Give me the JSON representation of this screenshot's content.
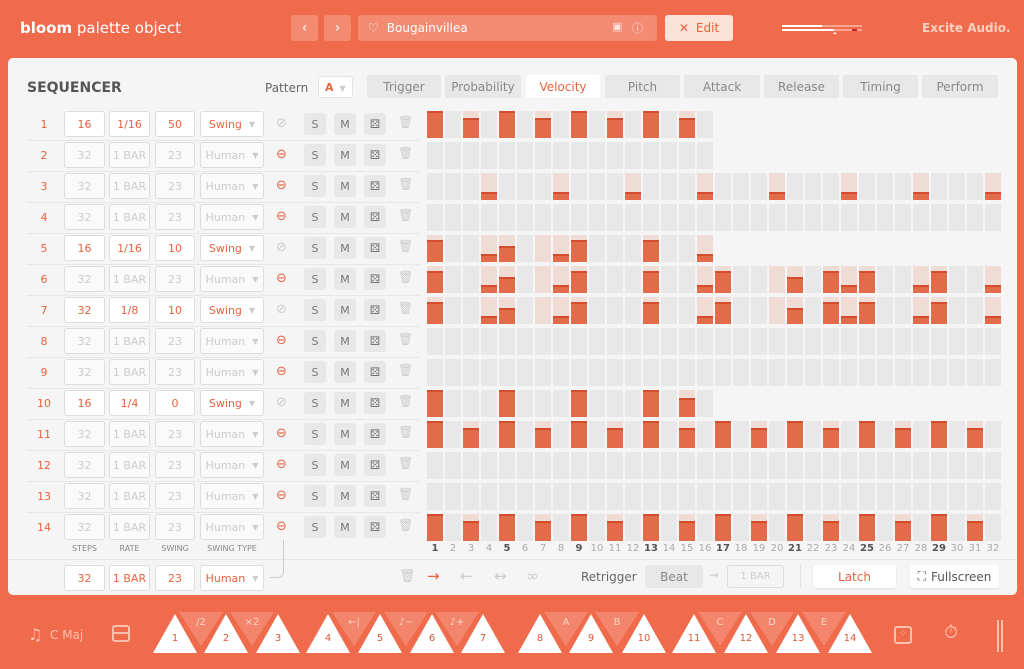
{
  "header": {
    "title_bold": "bloom",
    "title_rest": "palette object",
    "prev_icon": "chevron-left-icon",
    "next_icon": "chevron-right-icon",
    "preset_name": "Bougainvillea",
    "edit_label": "Edit",
    "brand": "Excite Audio."
  },
  "sequencer": {
    "title": "SEQUENCER",
    "pattern_label": "Pattern",
    "pattern_value": "A",
    "tabs": [
      {
        "label": "Trigger"
      },
      {
        "label": "Probability"
      },
      {
        "label": "Velocity",
        "active": true
      },
      {
        "label": "Pitch"
      },
      {
        "label": "Attack"
      },
      {
        "label": "Release"
      },
      {
        "label": "Timing"
      },
      {
        "label": "Perform"
      }
    ],
    "solo_label": "S",
    "mute_label": "M",
    "rows": [
      {
        "num": "1",
        "steps": "16",
        "rate": "1/16",
        "swing": "50",
        "swing_type": "Swing",
        "active": true,
        "linked": false,
        "visible_steps": 16,
        "velocity": {
          "1": 1,
          "3": 0.75,
          "5": 1,
          "7": 0.75,
          "9": 1,
          "11": 0.75,
          "13": 1,
          "15": 0.75
        },
        "ghost_only": []
      },
      {
        "num": "2",
        "steps": "32",
        "rate": "1 BAR",
        "swing": "23",
        "swing_type": "Human",
        "active": false,
        "linked": true,
        "visible_steps": 16,
        "velocity": {},
        "ghost_only": []
      },
      {
        "num": "3",
        "steps": "32",
        "rate": "1 BAR",
        "swing": "23",
        "swing_type": "Human",
        "active": false,
        "linked": true,
        "visible_steps": 32,
        "velocity": {
          "4": 0.3,
          "8": 0.3,
          "12": 0.3,
          "16": 0.3,
          "20": 0.3,
          "24": 0.3,
          "28": 0.3,
          "32": 0.3
        },
        "ghost_only": []
      },
      {
        "num": "4",
        "steps": "32",
        "rate": "1 BAR",
        "swing": "23",
        "swing_type": "Human",
        "active": false,
        "linked": true,
        "visible_steps": 32,
        "velocity": {},
        "ghost_only": []
      },
      {
        "num": "5",
        "steps": "16",
        "rate": "1/16",
        "swing": "10",
        "swing_type": "Swing",
        "active": true,
        "linked": false,
        "visible_steps": 16,
        "velocity": {
          "1": 0.8,
          "4": 0.3,
          "5": 0.6,
          "8": 0.3,
          "9": 0.8,
          "13": 0.8,
          "16": 0.3
        },
        "ghost_only": [
          7
        ]
      },
      {
        "num": "6",
        "steps": "32",
        "rate": "1 BAR",
        "swing": "23",
        "swing_type": "Human",
        "active": false,
        "linked": true,
        "visible_steps": 32,
        "velocity": {
          "1": 0.8,
          "4": 0.3,
          "5": 0.6,
          "8": 0.3,
          "9": 0.8,
          "13": 0.8,
          "16": 0.3,
          "17": 0.8,
          "21": 0.6,
          "23": 0.8,
          "24": 0.3,
          "25": 0.8,
          "28": 0.3,
          "29": 0.8,
          "32": 0.3
        },
        "ghost_only": [
          7,
          20
        ]
      },
      {
        "num": "7",
        "steps": "32",
        "rate": "1/8",
        "swing": "10",
        "swing_type": "Swing",
        "active": true,
        "linked": false,
        "visible_steps": 32,
        "velocity": {
          "1": 0.8,
          "4": 0.3,
          "5": 0.6,
          "8": 0.3,
          "9": 0.8,
          "13": 0.8,
          "16": 0.3,
          "17": 0.8,
          "21": 0.6,
          "23": 0.8,
          "24": 0.3,
          "25": 0.8,
          "28": 0.3,
          "29": 0.8,
          "32": 0.3
        },
        "ghost_only": [
          7,
          20
        ]
      },
      {
        "num": "8",
        "steps": "32",
        "rate": "1 BAR",
        "swing": "23",
        "swing_type": "Human",
        "active": false,
        "linked": true,
        "visible_steps": 32,
        "velocity": {},
        "ghost_only": []
      },
      {
        "num": "9",
        "steps": "32",
        "rate": "1 BAR",
        "swing": "23",
        "swing_type": "Human",
        "active": false,
        "linked": true,
        "visible_steps": 32,
        "velocity": {},
        "ghost_only": []
      },
      {
        "num": "10",
        "steps": "16",
        "rate": "1/4",
        "swing": "0",
        "swing_type": "Swing",
        "active": true,
        "linked": false,
        "visible_steps": 16,
        "velocity": {
          "1": 1,
          "5": 1,
          "9": 1,
          "13": 1,
          "15": 0.7
        },
        "ghost_only": []
      },
      {
        "num": "11",
        "steps": "32",
        "rate": "1 BAR",
        "swing": "23",
        "swing_type": "Human",
        "active": false,
        "linked": true,
        "visible_steps": 32,
        "velocity": {
          "1": 1,
          "3": 0.75,
          "5": 1,
          "7": 0.75,
          "9": 1,
          "11": 0.75,
          "13": 1,
          "15": 0.75,
          "17": 1,
          "19": 0.75,
          "21": 1,
          "23": 0.75,
          "25": 1,
          "27": 0.75,
          "29": 1,
          "31": 0.75
        },
        "ghost_only": []
      },
      {
        "num": "12",
        "steps": "32",
        "rate": "1 BAR",
        "swing": "23",
        "swing_type": "Human",
        "active": false,
        "linked": true,
        "visible_steps": 32,
        "velocity": {},
        "ghost_only": []
      },
      {
        "num": "13",
        "steps": "32",
        "rate": "1 BAR",
        "swing": "23",
        "swing_type": "Human",
        "active": false,
        "linked": true,
        "visible_steps": 32,
        "velocity": {},
        "ghost_only": []
      },
      {
        "num": "14",
        "steps": "32",
        "rate": "1 BAR",
        "swing": "23",
        "swing_type": "Human",
        "active": false,
        "linked": true,
        "visible_steps": 32,
        "velocity": {
          "1": 1,
          "3": 0.75,
          "5": 1,
          "7": 0.75,
          "9": 1,
          "11": 0.75,
          "13": 1,
          "15": 0.75,
          "17": 1,
          "19": 0.75,
          "21": 1,
          "23": 0.75,
          "25": 1,
          "27": 0.75,
          "29": 1,
          "31": 0.75
        },
        "ghost_only": []
      }
    ],
    "column_labels": {
      "steps": "STEPS",
      "rate": "RATE",
      "swing": "SWING",
      "swing_type": "SWING TYPE"
    },
    "step_numbers": [
      "1",
      "2",
      "3",
      "4",
      "5",
      "6",
      "7",
      "8",
      "9",
      "10",
      "11",
      "12",
      "13",
      "14",
      "15",
      "16",
      "17",
      "18",
      "19",
      "20",
      "21",
      "22",
      "23",
      "24",
      "25",
      "26",
      "27",
      "28",
      "29",
      "30",
      "31",
      "32"
    ],
    "global": {
      "steps": "32",
      "rate": "1 BAR",
      "swing": "23",
      "swing_type": "Human"
    },
    "direction_icons": [
      "trash-icon",
      "arrow-right-icon",
      "arrow-left-icon",
      "arrow-left-right-icon",
      "infinity-icon"
    ],
    "retrigger_label": "Retrigger",
    "retrigger_value": "Beat",
    "retrigger_length": "1 BAR",
    "latch_label": "Latch",
    "fullscreen_label": "Fullscreen"
  },
  "footer": {
    "scale": "C Maj",
    "pads": [
      "1",
      "2",
      "3",
      "4",
      "5",
      "6",
      "7",
      "8",
      "9",
      "10",
      "11",
      "12",
      "13",
      "14"
    ],
    "modifiers": [
      "/2",
      "×2",
      "←|",
      "♪−",
      "♪+",
      "A",
      "B",
      "C",
      "D",
      "E"
    ]
  },
  "colors": {
    "accent": "#F06B4C",
    "bar": "#E26B4A",
    "ghost": "#EFDCD5",
    "cell": "#E8E8E8"
  }
}
